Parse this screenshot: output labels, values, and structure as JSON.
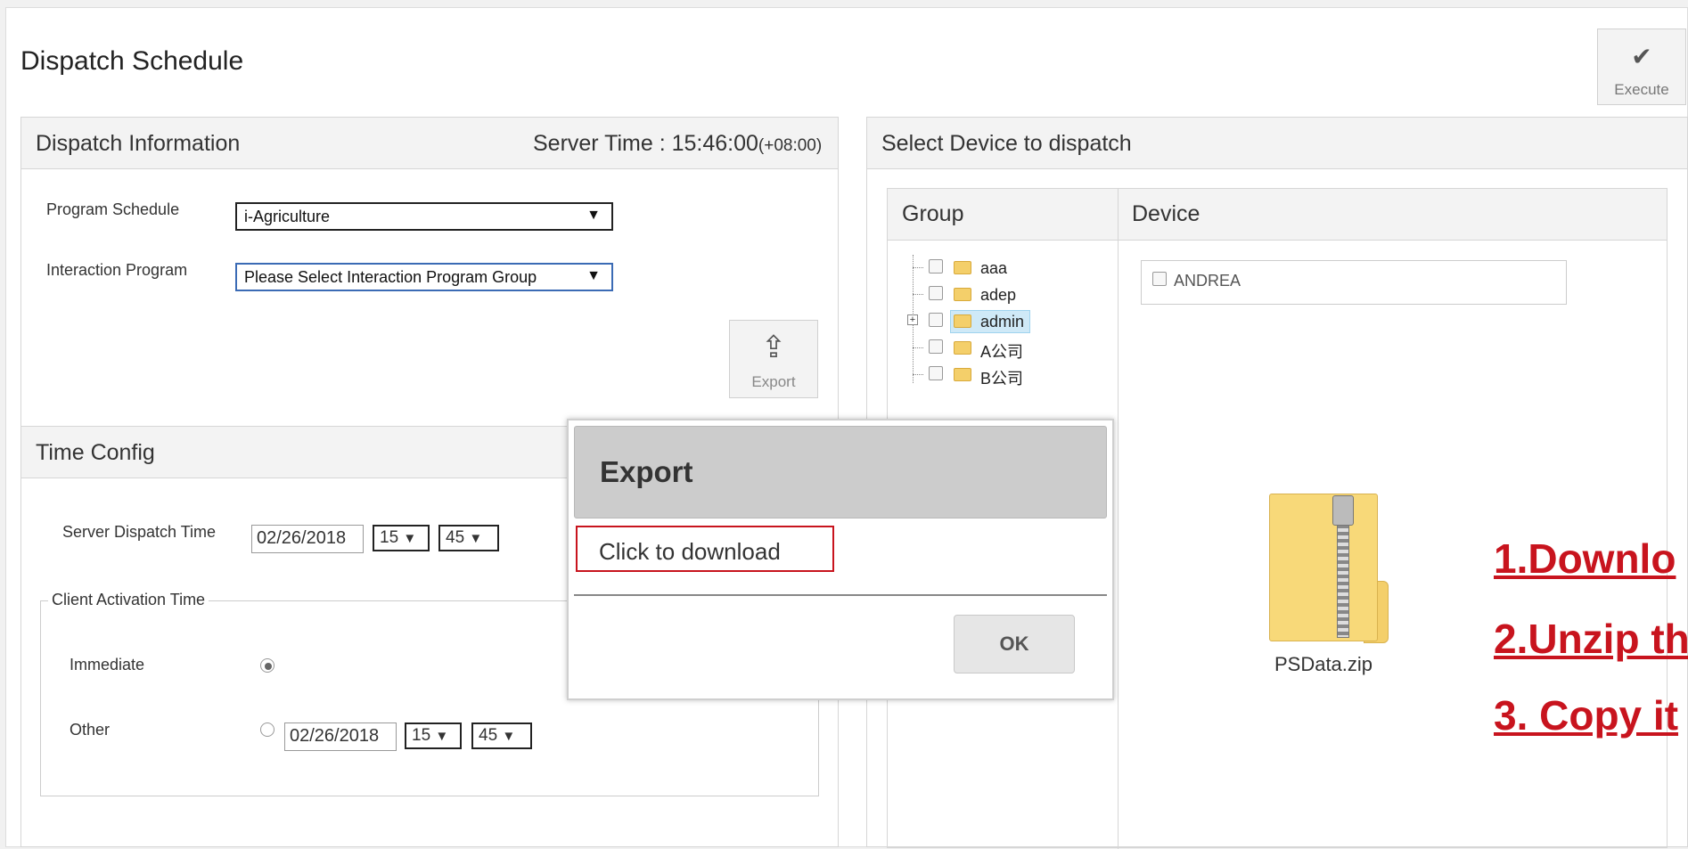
{
  "page": {
    "title": "Dispatch Schedule"
  },
  "toolbar": {
    "execute_label": "Execute",
    "execute_icon": "check-icon"
  },
  "dispatch_info": {
    "title": "Dispatch Information",
    "server_time_label": "Server Time : 15:46:00",
    "timezone": "(+08:00)",
    "program_schedule_label": "Program Schedule",
    "program_schedule_value": "i-Agriculture",
    "interaction_program_label": "Interaction Program",
    "interaction_program_value": "Please Select Interaction Program Group",
    "export_label": "Export",
    "export_icon": "share-icon"
  },
  "time_config": {
    "title": "Time Config",
    "server_dispatch_label": "Server Dispatch Time",
    "server_date": "02/26/2018",
    "server_hour": "15",
    "server_minute": "45",
    "client_activation_legend": "Client Activation Time",
    "immediate_label": "Immediate",
    "other_label": "Other",
    "other_date": "02/26/2018",
    "other_hour": "15",
    "other_minute": "45"
  },
  "select_device": {
    "title": "Select Device to dispatch",
    "group_header": "Group",
    "device_header": "Device",
    "groups": [
      "aaa",
      "adep",
      "admin",
      "A公司",
      "B公司"
    ],
    "selected_group": "admin",
    "devices": [
      "ANDREA"
    ]
  },
  "dialog": {
    "title": "Export",
    "link_text": "Click to download",
    "ok_label": "OK"
  },
  "file": {
    "name": "PSData.zip"
  },
  "notes": [
    "1.Downlo",
    "2.Unzip th",
    "3. Copy it"
  ],
  "colors": {
    "note_red": "#c8141e",
    "panel_header": "#f3f3f3"
  }
}
